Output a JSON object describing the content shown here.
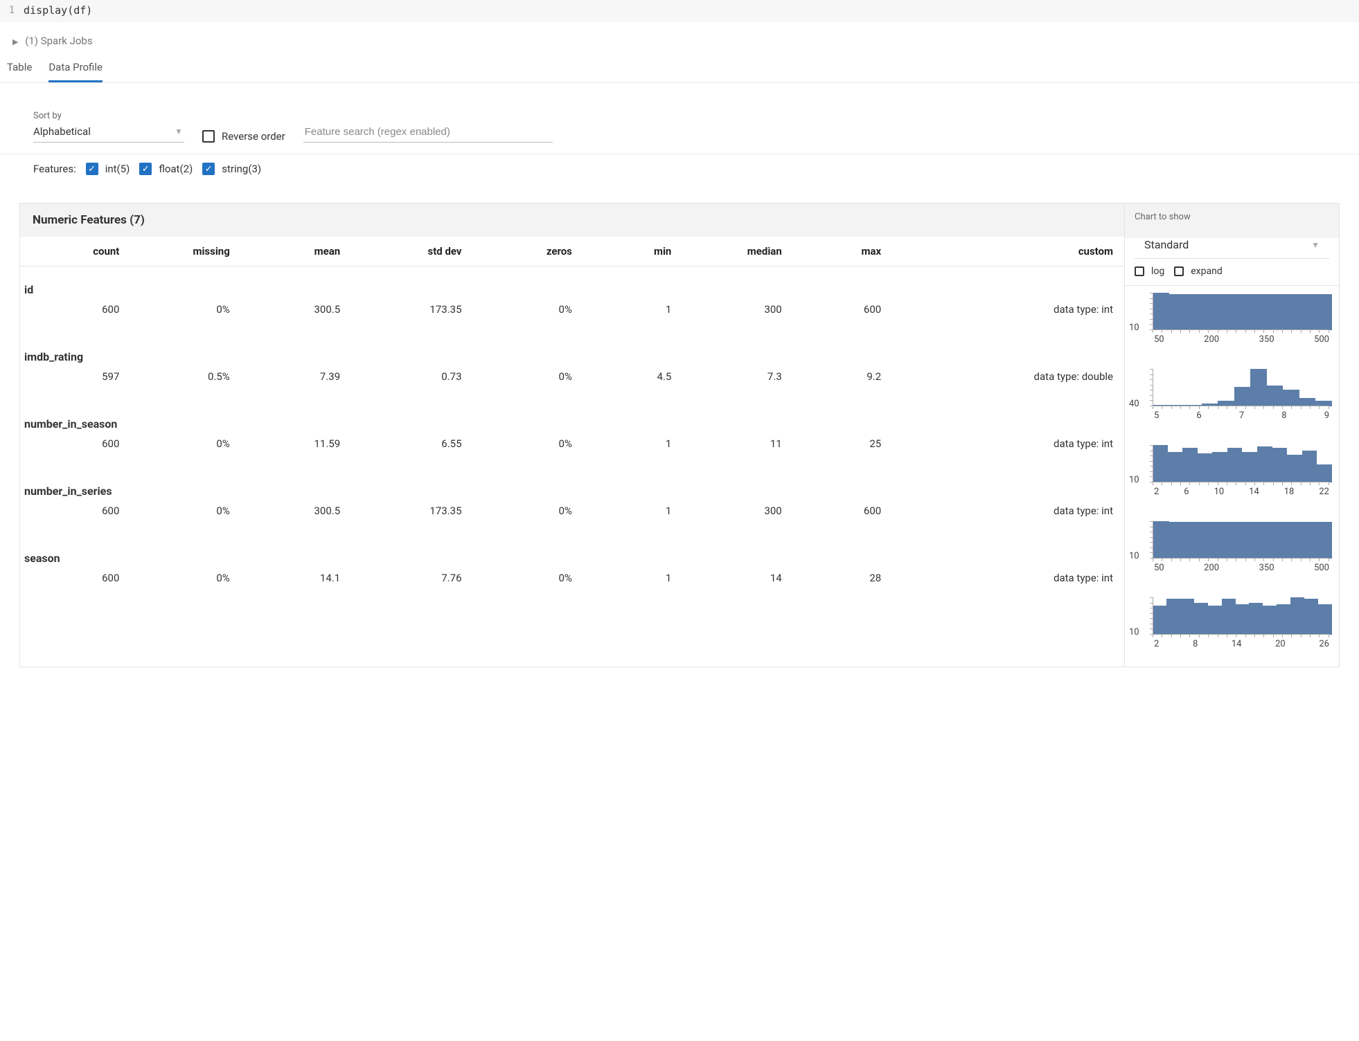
{
  "code": {
    "line_number": "1",
    "text": "display(df)"
  },
  "spark_jobs": {
    "label": "(1) Spark Jobs"
  },
  "tabs": {
    "table": "Table",
    "data_profile": "Data Profile"
  },
  "controls": {
    "sort_by_label": "Sort by",
    "sort_by_value": "Alphabetical",
    "reverse_order_label": "Reverse order",
    "search_placeholder": "Feature search (regex enabled)",
    "features_label": "Features:",
    "int_label": "int(5)",
    "float_label": "float(2)",
    "string_label": "string(3)"
  },
  "section": {
    "title": "Numeric Features (7)",
    "columns": {
      "count": "count",
      "missing": "missing",
      "mean": "mean",
      "std_dev": "std dev",
      "zeros": "zeros",
      "min": "min",
      "median": "median",
      "max": "max",
      "custom": "custom"
    }
  },
  "aside": {
    "chart_to_show": "Chart to show",
    "select_value": "Standard",
    "log_label": "log",
    "expand_label": "expand"
  },
  "features": [
    {
      "name": "id",
      "count": "600",
      "missing": "0%",
      "mean": "300.5",
      "std_dev": "173.35",
      "zeros": "0%",
      "min": "1",
      "median": "300",
      "max": "600",
      "custom": "data type: int"
    },
    {
      "name": "imdb_rating",
      "count": "597",
      "missing": "0.5%",
      "mean": "7.39",
      "std_dev": "0.73",
      "zeros": "0%",
      "min": "4.5",
      "median": "7.3",
      "max": "9.2",
      "custom": "data type: double"
    },
    {
      "name": "number_in_season",
      "count": "600",
      "missing": "0%",
      "mean": "11.59",
      "std_dev": "6.55",
      "zeros": "0%",
      "min": "1",
      "median": "11",
      "max": "25",
      "custom": "data type: int"
    },
    {
      "name": "number_in_series",
      "count": "600",
      "missing": "0%",
      "mean": "300.5",
      "std_dev": "173.35",
      "zeros": "0%",
      "min": "1",
      "median": "300",
      "max": "600",
      "custom": "data type: int"
    },
    {
      "name": "season",
      "count": "600",
      "missing": "0%",
      "mean": "14.1",
      "std_dev": "7.76",
      "zeros": "0%",
      "min": "1",
      "median": "14",
      "max": "28",
      "custom": "data type: int"
    }
  ],
  "chart_data": [
    {
      "type": "bar",
      "feature": "id",
      "y_sample": "10",
      "x_ticks": [
        "50",
        "200",
        "350",
        "500"
      ],
      "bars": [
        56,
        54,
        54,
        54,
        54,
        54,
        54,
        54,
        54,
        54,
        54
      ]
    },
    {
      "type": "bar",
      "feature": "imdb_rating",
      "y_sample": "40",
      "x_ticks": [
        "5",
        "6",
        "7",
        "8",
        "9"
      ],
      "bars": [
        2,
        2,
        2,
        4,
        8,
        28,
        54,
        30,
        24,
        12,
        8
      ]
    },
    {
      "type": "bar",
      "feature": "number_in_season",
      "y_sample": "10",
      "x_ticks": [
        "2",
        "6",
        "10",
        "14",
        "18",
        "22"
      ],
      "bars": [
        54,
        44,
        50,
        42,
        44,
        50,
        44,
        52,
        50,
        40,
        46,
        26
      ]
    },
    {
      "type": "bar",
      "feature": "number_in_series",
      "y_sample": "10",
      "x_ticks": [
        "50",
        "200",
        "350",
        "500"
      ],
      "bars": [
        55,
        54,
        54,
        54,
        54,
        54,
        54,
        54,
        54,
        54,
        54
      ]
    },
    {
      "type": "bar",
      "feature": "season",
      "y_sample": "10",
      "x_ticks": [
        "2",
        "8",
        "14",
        "20",
        "26"
      ],
      "bars": [
        40,
        50,
        50,
        44,
        40,
        50,
        42,
        44,
        40,
        42,
        52,
        50,
        42
      ]
    }
  ]
}
